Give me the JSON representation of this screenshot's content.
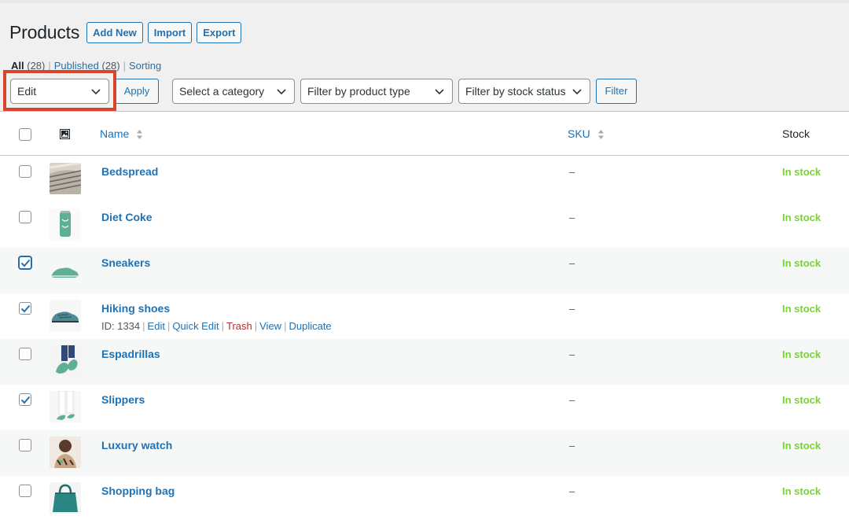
{
  "header": {
    "title": "Products",
    "actions": [
      "Add New",
      "Import",
      "Export"
    ]
  },
  "views": {
    "all": {
      "label": "All",
      "count": "(28)"
    },
    "published": {
      "label": "Published",
      "count": "(28)"
    },
    "sorting": {
      "label": "Sorting"
    },
    "separator": "|"
  },
  "tablenav": {
    "bulk_action": "Edit",
    "apply": "Apply",
    "category": "Select a category",
    "product_type": "Filter by product type",
    "stock_status": "Filter by stock status",
    "filter": "Filter"
  },
  "table": {
    "columns": {
      "name": "Name",
      "sku": "SKU",
      "stock": "Stock"
    },
    "rows": [
      {
        "name": "Bedspread",
        "sku": "–",
        "stock": "In stock",
        "checked": false
      },
      {
        "name": "Diet Coke",
        "sku": "–",
        "stock": "In stock",
        "checked": false
      },
      {
        "name": "Sneakers",
        "sku": "–",
        "stock": "In stock",
        "checked": true
      },
      {
        "name": "Hiking shoes",
        "sku": "–",
        "stock": "In stock",
        "checked": true
      },
      {
        "name": "Espadrillas",
        "sku": "–",
        "stock": "In stock",
        "checked": false
      },
      {
        "name": "Slippers",
        "sku": "–",
        "stock": "In stock",
        "checked": true
      },
      {
        "name": "Luxury watch",
        "sku": "–",
        "stock": "In stock",
        "checked": false
      },
      {
        "name": "Shopping bag",
        "sku": "–",
        "stock": "In stock",
        "checked": false
      }
    ],
    "row_actions": {
      "id": "ID: 1334",
      "edit": "Edit",
      "quick_edit": "Quick Edit",
      "trash": "Trash",
      "view": "View",
      "duplicate": "Duplicate",
      "separator": "|"
    }
  },
  "colors": {
    "link": "#2271b1",
    "in_stock": "#7ad03a",
    "trash": "#b32d2e",
    "highlight": "#d9442c",
    "background": "#f0f0f1"
  }
}
